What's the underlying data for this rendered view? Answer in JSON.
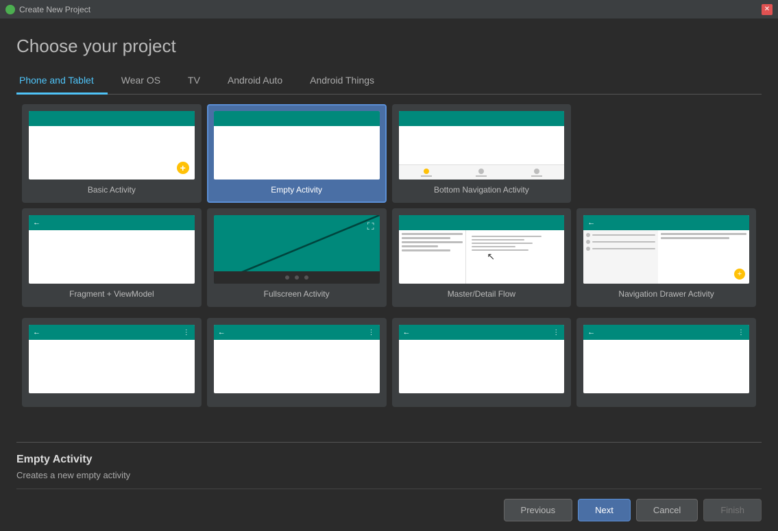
{
  "titleBar": {
    "icon": "android-studio-icon",
    "title": "Create New Project",
    "closeLabel": "✕"
  },
  "dialog": {
    "title": "Choose your project",
    "tabs": [
      {
        "id": "phone-tablet",
        "label": "Phone and Tablet",
        "active": true
      },
      {
        "id": "wear-os",
        "label": "Wear OS",
        "active": false
      },
      {
        "id": "tv",
        "label": "TV",
        "active": false
      },
      {
        "id": "android-auto",
        "label": "Android Auto",
        "active": false
      },
      {
        "id": "android-things",
        "label": "Android Things",
        "active": false
      }
    ],
    "projects": [
      {
        "id": "basic-activity",
        "label": "Basic Activity",
        "selected": false,
        "previewType": "basic"
      },
      {
        "id": "empty-activity",
        "label": "Empty Activity",
        "selected": true,
        "previewType": "empty"
      },
      {
        "id": "bottom-nav-activity",
        "label": "Bottom Navigation Activity",
        "selected": false,
        "previewType": "bottom-nav"
      },
      {
        "id": "fragment-viewmodel",
        "label": "Fragment + ViewModel",
        "selected": false,
        "previewType": "fragment"
      },
      {
        "id": "fullscreen-activity",
        "label": "Fullscreen Activity",
        "selected": false,
        "previewType": "fullscreen"
      },
      {
        "id": "master-detail-flow",
        "label": "Master/Detail Flow",
        "selected": false,
        "previewType": "master-detail"
      },
      {
        "id": "nav-drawer-activity",
        "label": "Navigation Drawer Activity",
        "selected": false,
        "previewType": "nav-drawer"
      },
      {
        "id": "partial1",
        "label": "",
        "selected": false,
        "previewType": "partial"
      }
    ],
    "selectedInfo": {
      "title": "Empty Activity",
      "description": "Creates a new empty activity"
    },
    "buttons": {
      "previous": "Previous",
      "next": "Next",
      "cancel": "Cancel",
      "finish": "Finish"
    }
  }
}
